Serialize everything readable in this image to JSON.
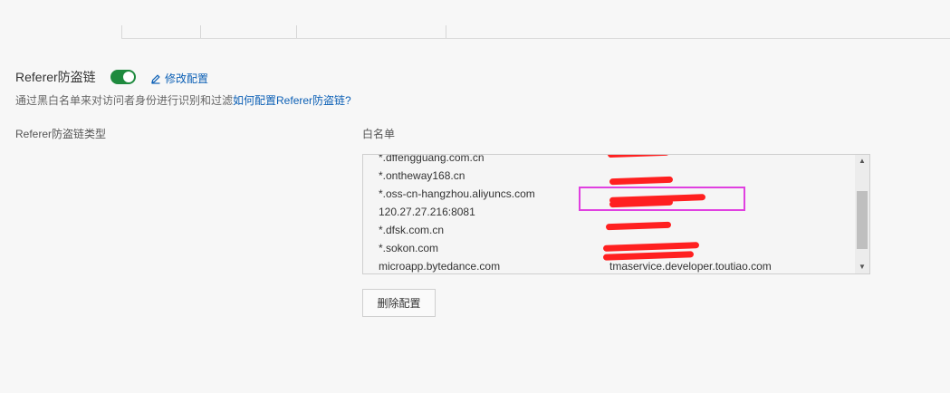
{
  "referer": {
    "title": "Referer防盗链",
    "enabled": true,
    "edit_label": "修改配置",
    "description_prefix": "通过黑白名单来对访问者身份进行识别和过滤",
    "description_link": "如何配置Referer防盗链?"
  },
  "type_label": "Referer防盗链类型",
  "whitelist": {
    "label": "白名单",
    "rows": [
      {
        "left": "*.dffengguang.com.cn",
        "right": ""
      },
      {
        "left": "*.ontheway168.cn",
        "right": ""
      },
      {
        "left": "*.oss-cn-hangzhou.aliyuncs.com",
        "right": ""
      },
      {
        "left": "120.27.27.216:8081",
        "right": ""
      },
      {
        "left": "*.dfsk.com.cn",
        "right": ""
      },
      {
        "left": "*.sokon.com",
        "right": ""
      },
      {
        "left": "microapp.bytedance.com",
        "right": "tmaservice.developer.toutiao.com"
      }
    ]
  },
  "delete_button": "删除配置",
  "colors": {
    "toggle_on": "#1e8a3e",
    "link": "#0b5fb5",
    "highlight": "#e040e0",
    "redaction": "#ff2020"
  }
}
